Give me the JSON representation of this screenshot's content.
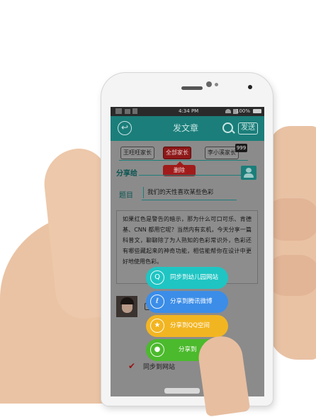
{
  "status_bar": {
    "time": "4:34 PM",
    "battery": "100%"
  },
  "app_bar": {
    "title": "发文章",
    "send_label": "发送",
    "back_glyph": "↩"
  },
  "recipients": {
    "chips": [
      "王旺旺家长",
      "全部家长",
      "李小溪家长"
    ],
    "count": "999",
    "delete_label": "删除",
    "share_label": "分享给"
  },
  "article": {
    "title_label": "题目",
    "title_value": "我们的天性喜欢某些色彩",
    "body": "如果红色是警告的暗示，那为什么可口可乐、肯德基、CNN 都用它呢？当然内有玄机，今天分享一篇科普文，聊聊除了为人熟知的色彩常识外，色彩还有哪些藏起来的神奇功能，相信能帮你在设计中更好地使用色彩。"
  },
  "share_options": [
    {
      "label": "同步到幼儿园网站",
      "icon": "q-icon",
      "color": "#1fc5c3"
    },
    {
      "label": "分享到腾讯微博",
      "icon": "tencent-weibo-icon",
      "color": "#3b8de8"
    },
    {
      "label": "分享到QQ空间",
      "icon": "qzone-star-icon",
      "color": "#f2b522"
    },
    {
      "label": "分享到",
      "icon": "wechat-icon",
      "color": "#4bba2c"
    }
  ],
  "sync": {
    "checked": true,
    "label": "同步到网站"
  }
}
